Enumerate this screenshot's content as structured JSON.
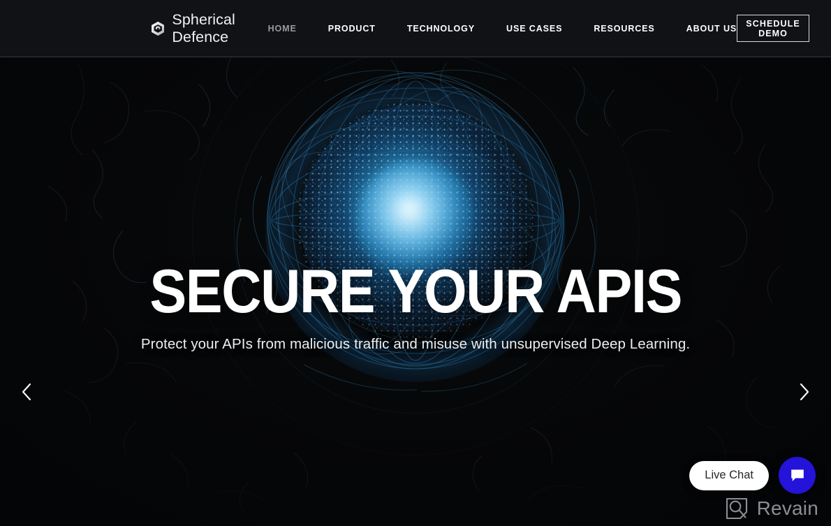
{
  "site": {
    "brand_name": "Spherical Defence",
    "logo_icon": "hexagon-ring-icon"
  },
  "header": {
    "nav": [
      {
        "label": "HOME",
        "active": true
      },
      {
        "label": "PRODUCT",
        "active": false
      },
      {
        "label": "TECHNOLOGY",
        "active": false
      },
      {
        "label": "USE CASES",
        "active": false
      },
      {
        "label": "RESOURCES",
        "active": false
      },
      {
        "label": "ABOUT US",
        "active": false
      }
    ],
    "cta_label": "SCHEDULE DEMO"
  },
  "hero": {
    "headline": "SECURE YOUR APIS",
    "subhead": "Protect your APIs from malicious traffic and misuse with unsupervised Deep Learning.",
    "prev_icon": "chevron-left-icon",
    "next_icon": "chevron-right-icon"
  },
  "chat": {
    "pill_label": "Live Chat",
    "fab_icon": "chat-bubble-icon"
  },
  "watermark": {
    "label": "Revain",
    "icon": "revain-logo-icon"
  },
  "colors": {
    "page_background": "#08090b",
    "header_background": "#111316",
    "nav_active": "#9b9b9b",
    "nav_default": "#ffffff",
    "accent_blue": "#2a9fe0",
    "chat_fab": "#2413d8",
    "text_primary": "#ffffff",
    "watermark_text": "#8b8e93"
  }
}
